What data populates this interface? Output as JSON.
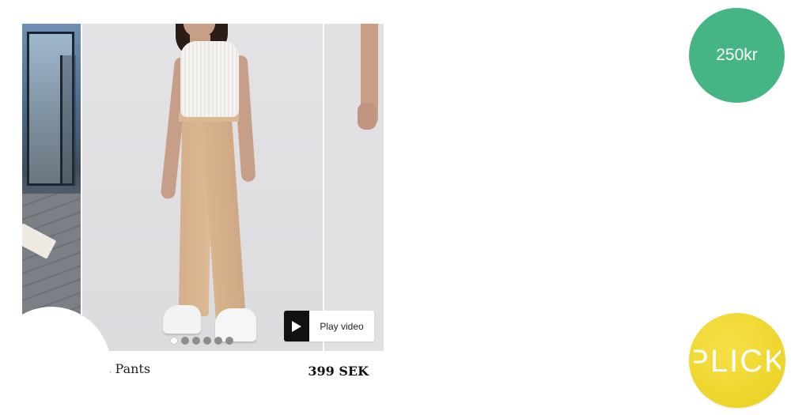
{
  "product": {
    "name_visible": "t Pants",
    "price": "399 SEK",
    "play_video_label": "Play video",
    "gallery_dot_count": 6,
    "gallery_active_index": 0
  },
  "badges": {
    "price": "250kr",
    "logo_text": "PLICK"
  },
  "colors": {
    "price_badge": "#45b586",
    "logo_badge": "#eed52a",
    "play_icon_bg": "#111111"
  },
  "icons": {
    "play": "play-icon"
  }
}
